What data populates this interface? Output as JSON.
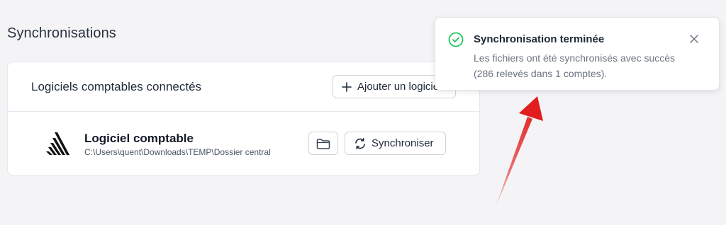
{
  "page": {
    "title": "Synchronisations"
  },
  "card": {
    "title": "Logiciels comptables connectés",
    "add_button_label": "Ajouter un logiciel",
    "software": {
      "name": "Logiciel comptable",
      "path": "C:\\Users\\quent\\Downloads\\TEMP\\Dossier central",
      "logo_icon": "logiciel-logo-icon",
      "folder_icon": "folder-icon",
      "sync_icon": "refresh-icon",
      "sync_label": "Synchroniser"
    }
  },
  "toast": {
    "icon": "check-circle-icon",
    "title": "Synchronisation terminée",
    "message": "Les fichiers ont été synchronisés avec succès (286 relevés dans 1 comptes).",
    "close_icon": "close-icon"
  },
  "colors": {
    "background": "#f4f4f6",
    "success_green": "#22c55e",
    "annotation_arrow": "#e11d1d"
  }
}
